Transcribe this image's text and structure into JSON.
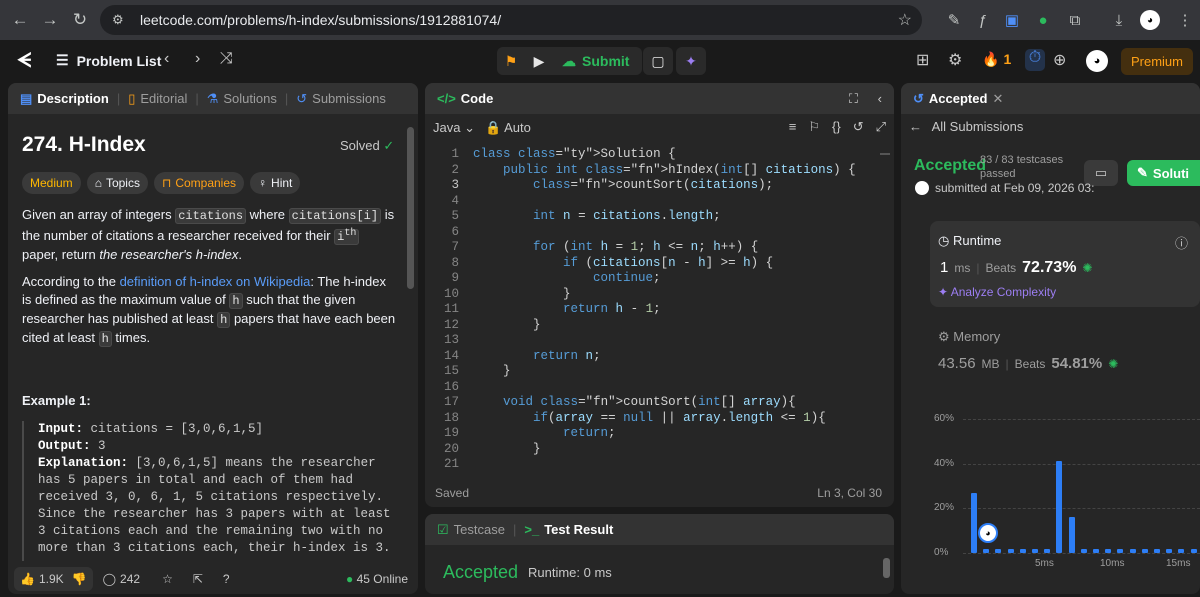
{
  "browser": {
    "url": "leetcode.com/problems/h-index/submissions/1912881074/"
  },
  "topbar": {
    "problem_list": "Problem List",
    "submit": "Submit",
    "streak": "1",
    "premium": "Premium"
  },
  "description": {
    "tabs": [
      "Description",
      "Editorial",
      "Solutions",
      "Submissions"
    ],
    "title": "274. H-Index",
    "status": "Solved",
    "tags": [
      "Medium",
      "Topics",
      "Companies",
      "Hint"
    ],
    "para1": {
      "t1": "Given an array of integers ",
      "c1": "citations",
      "t2": " where ",
      "c2": "citations[i]",
      "t3": " is the number of citations a researcher received for their ",
      "sup": "i",
      "supth": "th",
      "t4": " paper, return ",
      "em": "the researcher's h-index",
      "t5": "."
    },
    "para2": {
      "t1": "According to the ",
      "link": "definition of h-index on Wikipedia",
      "t2": ": The h-index is defined as the maximum value of ",
      "c1": "h",
      "t3": " such that the given researcher has published at least ",
      "c2": "h",
      "t4": " papers that have each been cited at least ",
      "c3": "h",
      "t5": " times."
    },
    "example_title": "Example 1:",
    "example": {
      "input_label": "Input:",
      "input": "citations = [3,0,6,1,5]",
      "output_label": "Output:",
      "output": "3",
      "expl_label": "Explanation:",
      "expl": "[3,0,6,1,5] means the researcher has 5 papers in total and each of them had received 3, 0, 6, 1, 5 citations respectively. Since the researcher has 3 papers with at least 3 citations each and the remaining two with no more than 3 citations each, their h-index is 3."
    },
    "likes": "1.9K",
    "comments": "242",
    "online": "45 Online"
  },
  "code": {
    "header": "Code",
    "language": "Java",
    "mode": "Auto",
    "saved": "Saved",
    "cursor": "Ln 3, Col 30",
    "lines": [
      "class Solution {",
      "    public int hIndex(int[] citations) {",
      "        countSort(citations);",
      "",
      "        int n = citations.length;",
      "",
      "        for (int h = 1; h <= n; h++) {",
      "            if (citations[n - h] >= h) {",
      "                continue;",
      "            }",
      "            return h - 1;",
      "        }",
      "",
      "        return n;",
      "    }",
      "",
      "    void countSort(int[] array){",
      "        if(array == null || array.length <= 1){",
      "            return;",
      "        }",
      ""
    ]
  },
  "testcase": {
    "tabs": [
      "Testcase",
      "Test Result"
    ],
    "status": "Accepted",
    "runtime": "Runtime: 0 ms"
  },
  "submission": {
    "tab": "Accepted",
    "back": "All Submissions",
    "status": "Accepted",
    "cases": "83 / 83 testcases passed",
    "solution_btn": "Soluti",
    "submitted": "submitted at Feb 09, 2026 03:",
    "runtime_label": "Runtime",
    "runtime_val": "1",
    "runtime_unit": "ms",
    "beats_label": "Beats",
    "runtime_beats": "72.73%",
    "analyze": "Analyze Complexity",
    "memory_label": "Memory",
    "memory_val": "43.56",
    "memory_unit": "MB",
    "memory_beats": "54.81%",
    "y_ticks": [
      "60%",
      "40%",
      "20%",
      "0%"
    ],
    "x_ticks": [
      "5ms",
      "10ms",
      "15ms"
    ]
  },
  "chart_data": {
    "type": "bar",
    "title": "",
    "xlabel": "",
    "ylabel": "",
    "ylim": [
      0,
      60
    ],
    "x_ticks": [
      "5ms",
      "10ms",
      "15ms"
    ],
    "values": [
      27,
      1,
      1,
      1,
      1,
      1,
      1,
      41,
      16,
      1,
      1,
      1,
      1,
      1,
      1,
      1,
      1,
      1,
      1,
      1,
      1,
      1
    ]
  }
}
